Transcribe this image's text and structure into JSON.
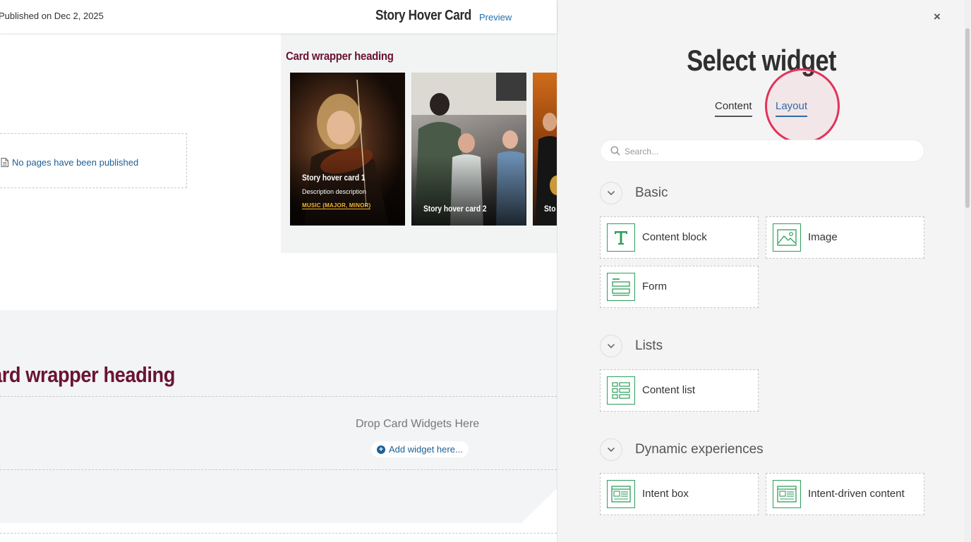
{
  "editor": {
    "published_text": "Published on Dec 2, 2025",
    "page_title": "Story Hover Card",
    "preview_label": "Preview",
    "no_pages_text": "No pages have been published",
    "card_wrapper_heading": "Card wrapper heading",
    "cards": [
      {
        "title": "Story hover card 1",
        "description": "Description description",
        "tag": "MUSIC (MAJOR, MINOR)"
      },
      {
        "title": "Story hover card 2"
      },
      {
        "title": "Sto"
      }
    ],
    "section2_heading": "ard wrapper heading",
    "drop_text": "Drop Card Widgets Here",
    "add_widget_label": "Add widget here..."
  },
  "panel": {
    "title": "Select widget",
    "close_label": "×",
    "tabs": [
      {
        "label": "Content",
        "active": false
      },
      {
        "label": "Layout",
        "active": true
      }
    ],
    "search_placeholder": "Search...",
    "sections": [
      {
        "label": "Basic",
        "widgets": [
          {
            "label": "Content block",
            "icon": "text-t-icon"
          },
          {
            "label": "Image",
            "icon": "image-icon"
          },
          {
            "label": "Form",
            "icon": "form-icon"
          }
        ]
      },
      {
        "label": "Lists",
        "widgets": [
          {
            "label": "Content list",
            "icon": "list-icon"
          }
        ]
      },
      {
        "label": "Dynamic experiences",
        "widgets": [
          {
            "label": "Intent box",
            "icon": "intent-box-icon"
          },
          {
            "label": "Intent-driven content",
            "icon": "intent-content-icon"
          }
        ]
      }
    ]
  },
  "colors": {
    "accent_green": "#2f9e5b",
    "link_blue": "#1f6fae",
    "heading_maroon": "#6a1333",
    "highlight_red": "#e0335a"
  }
}
